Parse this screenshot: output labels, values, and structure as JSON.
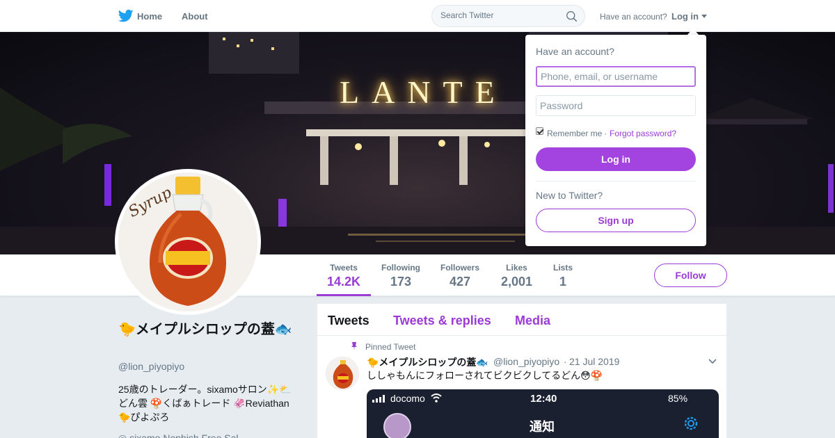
{
  "colors": {
    "accent": "#9b3bd6",
    "login_button": "#a444e0",
    "muted": "#657786",
    "background": "#e6ecf0"
  },
  "nav": {
    "logo_icon": "twitter-bird-icon",
    "home_label": "Home",
    "about_label": "About",
    "search_placeholder": "Search Twitter",
    "have_account": "Have an account?",
    "login_label": "Log in"
  },
  "banner": {
    "sign_text": "LANTE"
  },
  "profile": {
    "name": "🐤メイプルシロップの蓋🐟",
    "handle": "@lion_piyopiyo",
    "bio": "25歳のトレーダー。sixamoサロン✨⛅どん雲 🍄くばぁトレード 🦑Reviathan 🐤ぴよぷろ",
    "location_partial": "◎ sixamo Nophish Free Sal",
    "avatar_text": "Syrup"
  },
  "stats": [
    {
      "label": "Tweets",
      "value": "14.2K"
    },
    {
      "label": "Following",
      "value": "173"
    },
    {
      "label": "Followers",
      "value": "427"
    },
    {
      "label": "Likes",
      "value": "2,001"
    },
    {
      "label": "Lists",
      "value": "1"
    }
  ],
  "follow_label": "Follow",
  "tabs": [
    "Tweets",
    "Tweets & replies",
    "Media"
  ],
  "tweet": {
    "pinned_label": "Pinned Tweet",
    "author": "🐤メイプルシロップの蓋🐟",
    "handle": "@lion_piyopiyo",
    "separator": "·",
    "date": "21 Jul 2019",
    "text": "ししゃもんにフォローされてビクビクしてるどん😳🍄",
    "media": {
      "carrier": "docomo",
      "time": "12:40",
      "battery": "85%",
      "title": "通知"
    }
  },
  "login_dropdown": {
    "title": "Have an account?",
    "username_placeholder": "Phone, email, or username",
    "password_placeholder": "Password",
    "remember_label": "Remember me",
    "dot": "·",
    "forgot_label": "Forgot password?",
    "login_button": "Log in",
    "new_label": "New to Twitter?",
    "signup_button": "Sign up"
  }
}
